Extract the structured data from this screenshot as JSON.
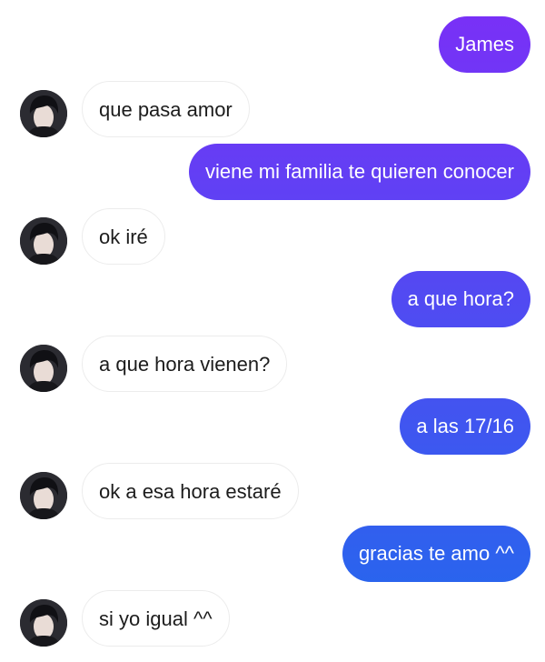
{
  "conversation": {
    "messages": [
      {
        "side": "sent",
        "text": "James"
      },
      {
        "side": "received",
        "text": "que pasa amor"
      },
      {
        "side": "sent",
        "text": "viene mi familia te quieren conocer"
      },
      {
        "side": "received",
        "text": "ok iré"
      },
      {
        "side": "sent",
        "text": "a que hora?"
      },
      {
        "side": "received",
        "text": "a que hora vienen?"
      },
      {
        "side": "sent",
        "text": "a las 17/16"
      },
      {
        "side": "received",
        "text": "ok a esa hora estaré"
      },
      {
        "side": "sent",
        "text": "gracias te amo ^^"
      },
      {
        "side": "received",
        "text": "si yo igual ^^"
      }
    ]
  },
  "colors": {
    "sent_bubble_purple": "#7b2ff7",
    "sent_bubble_blue": "#1f6bec",
    "received_bubble_bg": "#ffffff",
    "received_bubble_border": "#ececec",
    "received_text": "#1c1c1c",
    "sent_text": "#ffffff"
  },
  "icons": {
    "contact_avatar": "contact-avatar-icon"
  }
}
